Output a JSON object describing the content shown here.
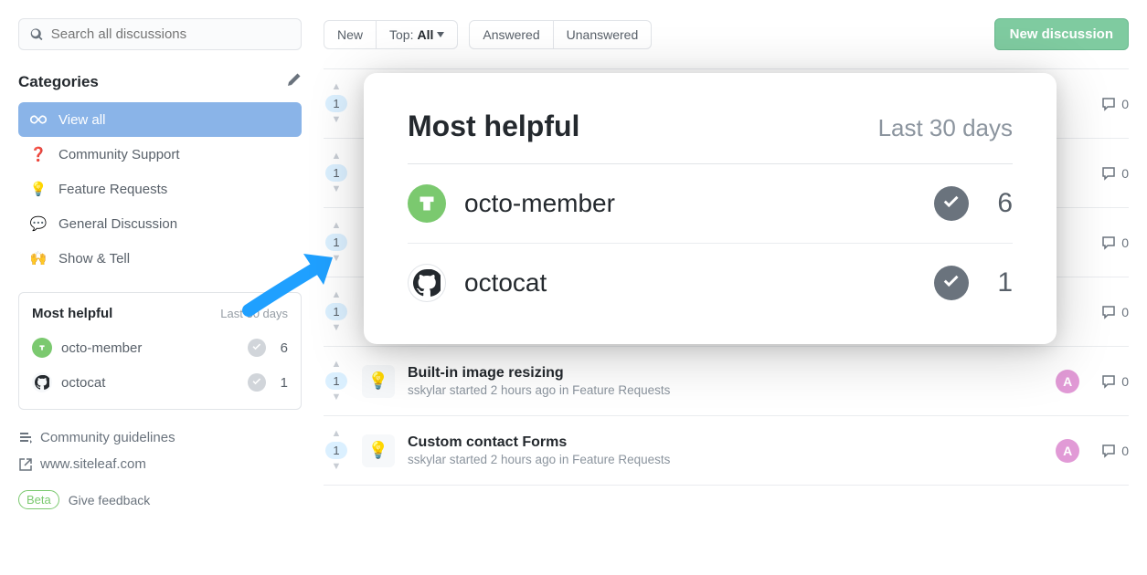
{
  "search": {
    "placeholder": "Search all discussions"
  },
  "toolbar": {
    "new": "New",
    "top_prefix": "Top: ",
    "top_value": "All",
    "answered": "Answered",
    "unanswered": "Unanswered",
    "new_discussion": "New discussion"
  },
  "categories": {
    "header": "Categories",
    "items": [
      {
        "label": "View all",
        "icon": "infinity"
      },
      {
        "label": "Community Support",
        "icon": "question"
      },
      {
        "label": "Feature Requests",
        "icon": "bulb"
      },
      {
        "label": "General Discussion",
        "icon": "chat"
      },
      {
        "label": "Show & Tell",
        "icon": "hands"
      }
    ]
  },
  "helpful": {
    "title": "Most helpful",
    "period": "Last 30 days",
    "rows": [
      {
        "name": "octo-member",
        "count": "6",
        "avatar": "member"
      },
      {
        "name": "octocat",
        "count": "1",
        "avatar": "octocat"
      }
    ]
  },
  "links": {
    "guidelines": "Community guidelines",
    "site": "www.siteleaf.com"
  },
  "feedback": {
    "badge": "Beta",
    "label": "Give feedback"
  },
  "discussions": [
    {
      "votes": "1",
      "comments": "0",
      "blank": true
    },
    {
      "votes": "1",
      "comments": "0",
      "blank": true
    },
    {
      "votes": "1",
      "comments": "0",
      "blank": true
    },
    {
      "votes": "1",
      "comments": "0",
      "blank": true
    },
    {
      "votes": "1",
      "title": "Built-in image resizing",
      "meta": "sskylar started 2 hours ago in Feature Requests",
      "comments": "0",
      "avatar_bg": "#e19ad6"
    },
    {
      "votes": "1",
      "title": "Custom contact Forms",
      "meta": "sskylar started 2 hours ago in Feature Requests",
      "comments": "0",
      "avatar_bg": "#e19ad6"
    }
  ],
  "overlay": {
    "title": "Most helpful",
    "period": "Last 30 days",
    "rows": [
      {
        "name": "octo-member",
        "count": "6",
        "avatar": "member"
      },
      {
        "name": "octocat",
        "count": "1",
        "avatar": "octocat"
      }
    ]
  },
  "colors": {
    "arrow": "#1fa0ff"
  }
}
